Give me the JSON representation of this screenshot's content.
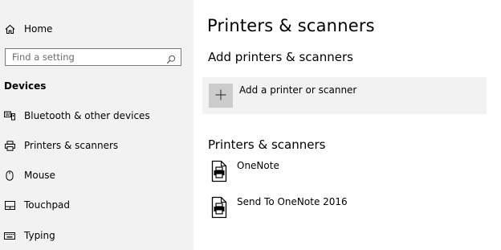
{
  "sidebar": {
    "home": {
      "label": "Home",
      "icon": "home-icon"
    },
    "search": {
      "placeholder": "Find a setting",
      "value": "",
      "icon": "search-icon"
    },
    "section_heading": "Devices",
    "items": [
      {
        "label": "Bluetooth & other devices",
        "icon": "bluetooth-devices-icon"
      },
      {
        "label": "Printers & scanners",
        "icon": "printer-icon"
      },
      {
        "label": "Mouse",
        "icon": "mouse-icon"
      },
      {
        "label": "Touchpad",
        "icon": "touchpad-icon"
      },
      {
        "label": "Typing",
        "icon": "keyboard-icon"
      }
    ]
  },
  "main": {
    "title": "Printers & scanners",
    "add_section": {
      "heading": "Add printers & scanners",
      "button_label": "Add a printer or scanner",
      "icon": "plus-icon"
    },
    "list_section": {
      "heading": "Printers & scanners",
      "printers": [
        {
          "name": "OneNote",
          "icon": "printer-document-icon"
        },
        {
          "name": "Send To OneNote 2016",
          "icon": "printer-document-icon"
        }
      ]
    }
  },
  "colors": {
    "sidebar_bg": "#f2f2f2",
    "add_row_bg": "#f2f2f2",
    "add_tile_bg": "#cccccc",
    "text": "#000000"
  }
}
